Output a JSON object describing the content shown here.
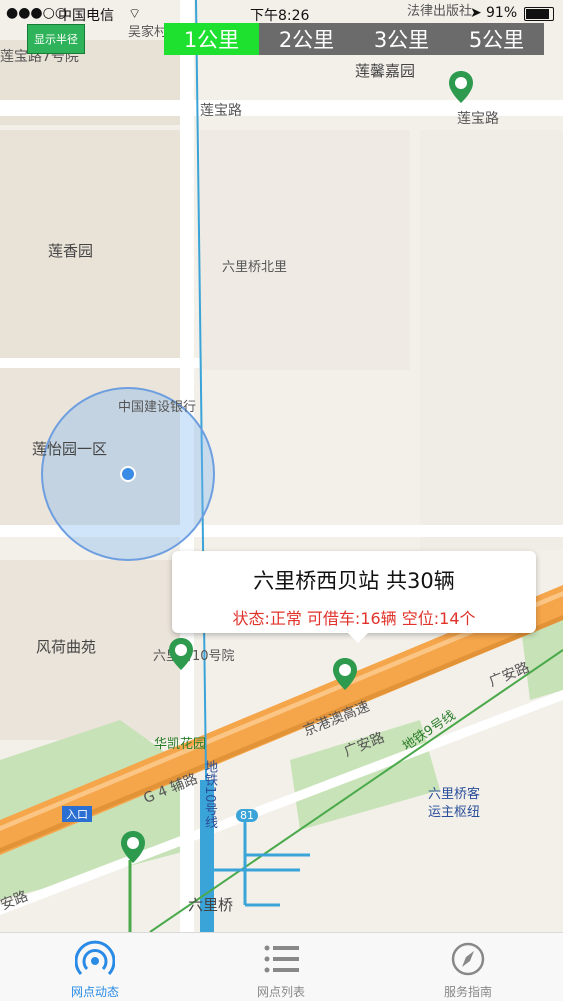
{
  "status_bar": {
    "carrier": "中国电信",
    "time": "下午8:26",
    "battery": "91%"
  },
  "radius": {
    "toggle_label": "显示半径",
    "tabs": [
      {
        "label": "1公里",
        "active": true
      },
      {
        "label": "2公里",
        "active": false
      },
      {
        "label": "3公里",
        "active": false
      },
      {
        "label": "5公里",
        "active": false
      }
    ]
  },
  "map": {
    "labels": {
      "wujiacun": "吴家村",
      "falv": "法律出版社",
      "lianbaolu7": "莲宝路7号院",
      "lianxinjiayuan": "莲馨嘉园",
      "lianbaolu_left": "莲宝路",
      "lianbaolu_right": "莲宝路",
      "lianxiangyuan": "莲香园",
      "liuliqiaobeili": "六里桥北里",
      "jianshe": "中国建设银行",
      "lianyiyuan": "莲怡园一区",
      "fengheyuan": "风荷曲苑",
      "liuliqiao10": "六里桥10号院",
      "jinggangao": "京港澳高速",
      "guanganlu_right": "广安路",
      "guanganlu_mid": "广安路",
      "guanganlu_left": "安路",
      "huakaihuayuan": "华凯花园",
      "g4": "G 4 辅路",
      "metro10": "地铁10号线",
      "metro9": "地铁9号线",
      "liuliqiaokeyun": "六里桥客运主枢纽",
      "liuliqiao": "六里桥",
      "entrance": "入口",
      "bus81": "81"
    }
  },
  "popup": {
    "title": "六里桥西贝站  共30辆",
    "status": "状态:正常 可借车:16辆 空位:14个"
  },
  "tabbar": {
    "items": [
      {
        "label": "网点动态",
        "active": true
      },
      {
        "label": "网点列表",
        "active": false
      },
      {
        "label": "服务指南",
        "active": false
      }
    ]
  },
  "colors": {
    "active_tab": "#1ee02e",
    "accent_blue": "#2a8be6",
    "status_red": "#e0332b",
    "marker_green": "#2e9a4e",
    "highway_orange": "#f5a54a"
  }
}
